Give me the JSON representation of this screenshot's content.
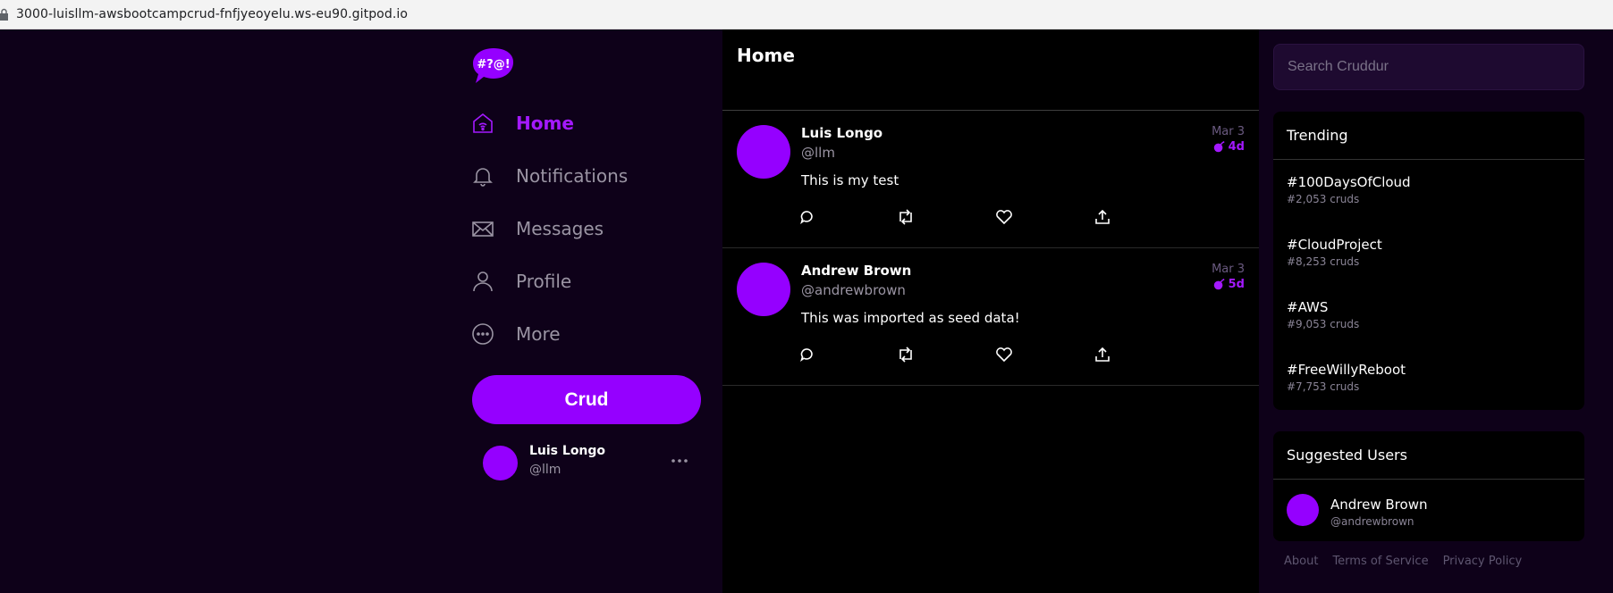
{
  "browser": {
    "url": "3000-luisllm-awsbootcampcrud-fnfjyeoyelu.ws-eu90.gitpod.io"
  },
  "brand": {
    "logo_text": "#?@!",
    "accent": "#9500ff",
    "background": "#0e0119"
  },
  "nav": {
    "items": [
      {
        "label": "Home",
        "icon": "home-icon"
      },
      {
        "label": "Notifications",
        "icon": "bell-icon"
      },
      {
        "label": "Messages",
        "icon": "envelope-icon"
      },
      {
        "label": "Profile",
        "icon": "person-icon"
      },
      {
        "label": "More",
        "icon": "more-circle-icon"
      }
    ],
    "crud_label": "Crud"
  },
  "current_user": {
    "name": "Luis Longo",
    "handle": "@llm"
  },
  "feed": {
    "title": "Home",
    "posts": [
      {
        "name": "Luis Longo",
        "handle": "@llm",
        "text": "This is my test",
        "date": "Mar 3",
        "expires": "4d"
      },
      {
        "name": "Andrew Brown",
        "handle": "@andrewbrown",
        "text": "This was imported as seed data!",
        "date": "Mar 3",
        "expires": "5d"
      }
    ]
  },
  "search": {
    "placeholder": "Search Cruddur"
  },
  "trending": {
    "title": "Trending",
    "items": [
      {
        "tag": "#100DaysOfCloud",
        "count": "#2,053 cruds"
      },
      {
        "tag": "#CloudProject",
        "count": "#8,253 cruds"
      },
      {
        "tag": "#AWS",
        "count": "#9,053 cruds"
      },
      {
        "tag": "#FreeWillyReboot",
        "count": "#7,753 cruds"
      }
    ]
  },
  "suggested": {
    "title": "Suggested Users",
    "users": [
      {
        "name": "Andrew Brown",
        "handle": "@andrewbrown"
      }
    ]
  },
  "footer": {
    "links": [
      "About",
      "Terms of Service",
      "Privacy Policy"
    ]
  }
}
